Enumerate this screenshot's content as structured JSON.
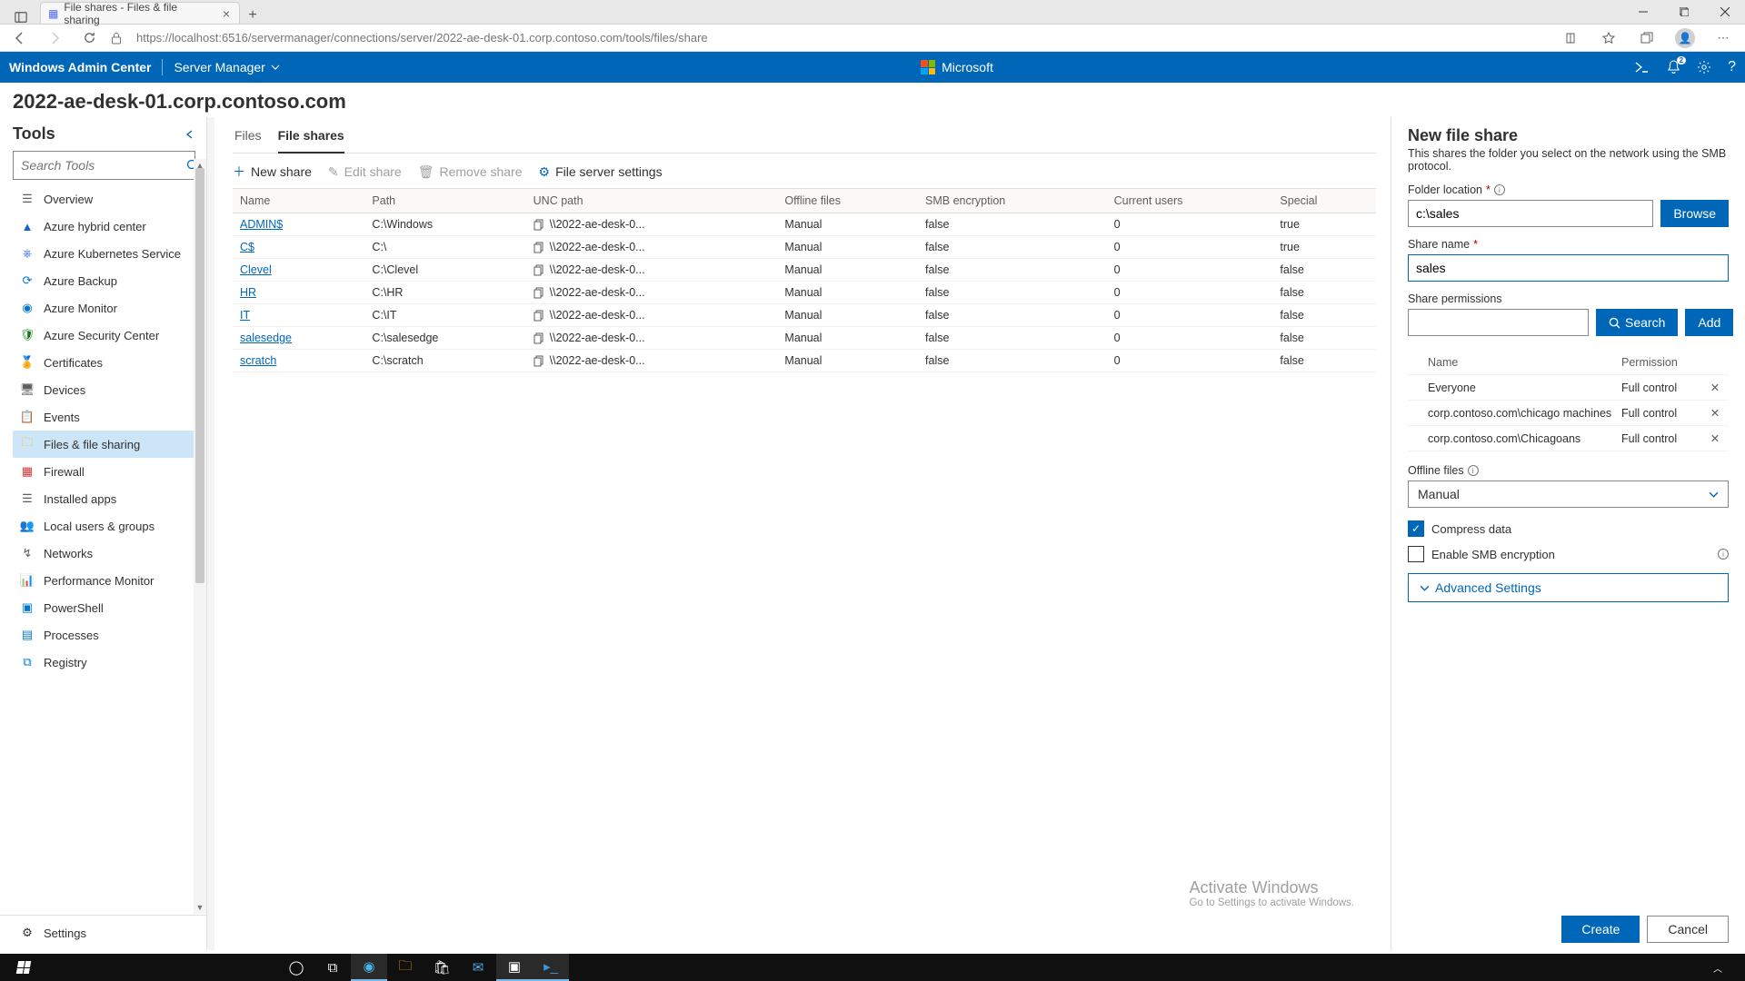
{
  "browser": {
    "tab_title": "File shares - Files & file sharing ",
    "url": "https://localhost:6516/servermanager/connections/server/2022-ae-desk-01.corp.contoso.com/tools/files/share"
  },
  "appbar": {
    "product": "Windows Admin Center",
    "context": "Server Manager",
    "brand": "Microsoft",
    "notif_count": "2"
  },
  "page_title": "2022-ae-desk-01.corp.contoso.com",
  "tools": {
    "heading": "Tools",
    "search_placeholder": "Search Tools",
    "items": [
      {
        "label": "Overview",
        "color": "#605e5c"
      },
      {
        "label": "Azure hybrid center",
        "color": "#1565c0"
      },
      {
        "label": "Azure Kubernetes Service",
        "color": "#326ce5"
      },
      {
        "label": "Azure Backup",
        "color": "#0078d4"
      },
      {
        "label": "Azure Monitor",
        "color": "#0078d4"
      },
      {
        "label": "Azure Security Center",
        "color": "#107c10"
      },
      {
        "label": "Certificates",
        "color": "#e3b341"
      },
      {
        "label": "Devices",
        "color": "#605e5c"
      },
      {
        "label": "Events",
        "color": "#0078d4"
      },
      {
        "label": "Files & file sharing",
        "color": "#ffb900"
      },
      {
        "label": "Firewall",
        "color": "#d13438"
      },
      {
        "label": "Installed apps",
        "color": "#605e5c"
      },
      {
        "label": "Local users & groups",
        "color": "#0078d4"
      },
      {
        "label": "Networks",
        "color": "#605e5c"
      },
      {
        "label": "Performance Monitor",
        "color": "#0078d4"
      },
      {
        "label": "PowerShell",
        "color": "#0078d4"
      },
      {
        "label": "Processes",
        "color": "#0078d4"
      },
      {
        "label": "Registry",
        "color": "#0078d4"
      }
    ],
    "settings": "Settings"
  },
  "tabs": {
    "files": "Files",
    "shares": "File shares"
  },
  "toolbar": {
    "new_share": "New share",
    "edit_share": "Edit share",
    "remove_share": "Remove share",
    "server_settings": "File server settings"
  },
  "grid": {
    "headers": {
      "name": "Name",
      "path": "Path",
      "unc": "UNC path",
      "offline": "Offline files",
      "smb": "SMB encryption",
      "users": "Current users",
      "special": "Special"
    },
    "rows": [
      {
        "name": "ADMIN$",
        "path": "C:\\Windows",
        "unc": "\\\\2022-ae-desk-0...",
        "offline": "Manual",
        "smb": "false",
        "users": "0",
        "special": "true"
      },
      {
        "name": "C$",
        "path": "C:\\",
        "unc": "\\\\2022-ae-desk-0...",
        "offline": "Manual",
        "smb": "false",
        "users": "0",
        "special": "true"
      },
      {
        "name": "Clevel",
        "path": "C:\\Clevel",
        "unc": "\\\\2022-ae-desk-0...",
        "offline": "Manual",
        "smb": "false",
        "users": "0",
        "special": "false"
      },
      {
        "name": "HR",
        "path": "C:\\HR",
        "unc": "\\\\2022-ae-desk-0...",
        "offline": "Manual",
        "smb": "false",
        "users": "0",
        "special": "false"
      },
      {
        "name": "IT",
        "path": "C:\\IT",
        "unc": "\\\\2022-ae-desk-0...",
        "offline": "Manual",
        "smb": "false",
        "users": "0",
        "special": "false"
      },
      {
        "name": "salesedge",
        "path": "C:\\salesedge",
        "unc": "\\\\2022-ae-desk-0...",
        "offline": "Manual",
        "smb": "false",
        "users": "0",
        "special": "false"
      },
      {
        "name": "scratch",
        "path": "C:\\scratch",
        "unc": "\\\\2022-ae-desk-0...",
        "offline": "Manual",
        "smb": "false",
        "users": "0",
        "special": "false"
      }
    ]
  },
  "flyout": {
    "title": "New file share",
    "subtitle": "This shares the folder you select on the network using the SMB protocol.",
    "folder_label": "Folder location",
    "folder_value": "c:\\sales",
    "browse": "Browse",
    "share_label": "Share name",
    "share_value": "sales",
    "perm_label": "Share permissions",
    "search": "Search",
    "add": "Add",
    "perm_head_name": "Name",
    "perm_head_val": "Permission",
    "perms": [
      {
        "name": "Everyone",
        "val": "Full control"
      },
      {
        "name": "corp.contoso.com\\chicago machines",
        "val": "Full control"
      },
      {
        "name": "corp.contoso.com\\Chicagoans",
        "val": "Full control"
      }
    ],
    "offline_label": "Offline files",
    "offline_value": "Manual",
    "compress": "Compress data",
    "smb_enc": "Enable SMB encryption",
    "adv": "Advanced Settings",
    "create": "Create",
    "cancel": "Cancel"
  },
  "watermark": {
    "l1": "Activate Windows",
    "l2": "Go to Settings to activate Windows."
  }
}
